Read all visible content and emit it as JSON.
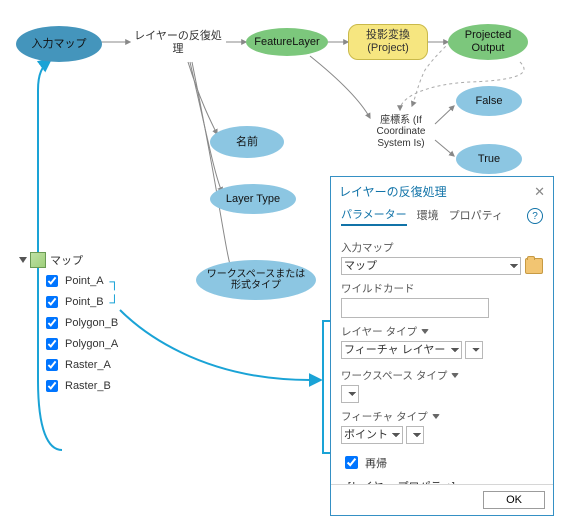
{
  "graph": {
    "input_map": "入力マップ",
    "iterate": "レイヤーの反復処\n理",
    "feature_layer": "FeatureLayer",
    "project": "投影変換\n(Project)",
    "projected_output": "Projected\nOutput",
    "name": "名前",
    "if_crs": "座標系 (If\nCoordinate\nSystem Is)",
    "false": "False",
    "true": "True",
    "layer_type": "Layer Type",
    "workspace_or_format": "ワークスペースまたは\n形式タイプ"
  },
  "tree": {
    "root": "マップ",
    "items": [
      "Point_A",
      "Point_B",
      "Polygon_B",
      "Polygon_A",
      "Raster_A",
      "Raster_B"
    ]
  },
  "panel": {
    "title": "レイヤーの反復処理",
    "tabs": {
      "param": "パラメーター",
      "env": "環境",
      "prop": "プロパティ"
    },
    "fields": {
      "input_map_lbl": "入力マップ",
      "input_map_val": "マップ",
      "wildcard_lbl": "ワイルドカード",
      "layer_type_lbl": "レイヤー タイプ",
      "layer_type_val": "フィーチャ レイヤー",
      "workspace_type_lbl": "ワークスペース タイプ",
      "feature_type_lbl": "フィーチャ タイプ",
      "feature_type_val": "ポイント",
      "recurse_lbl": "再帰",
      "layer_prop_lbl": "[レイヤー プロパティ]"
    },
    "ok": "OK"
  }
}
